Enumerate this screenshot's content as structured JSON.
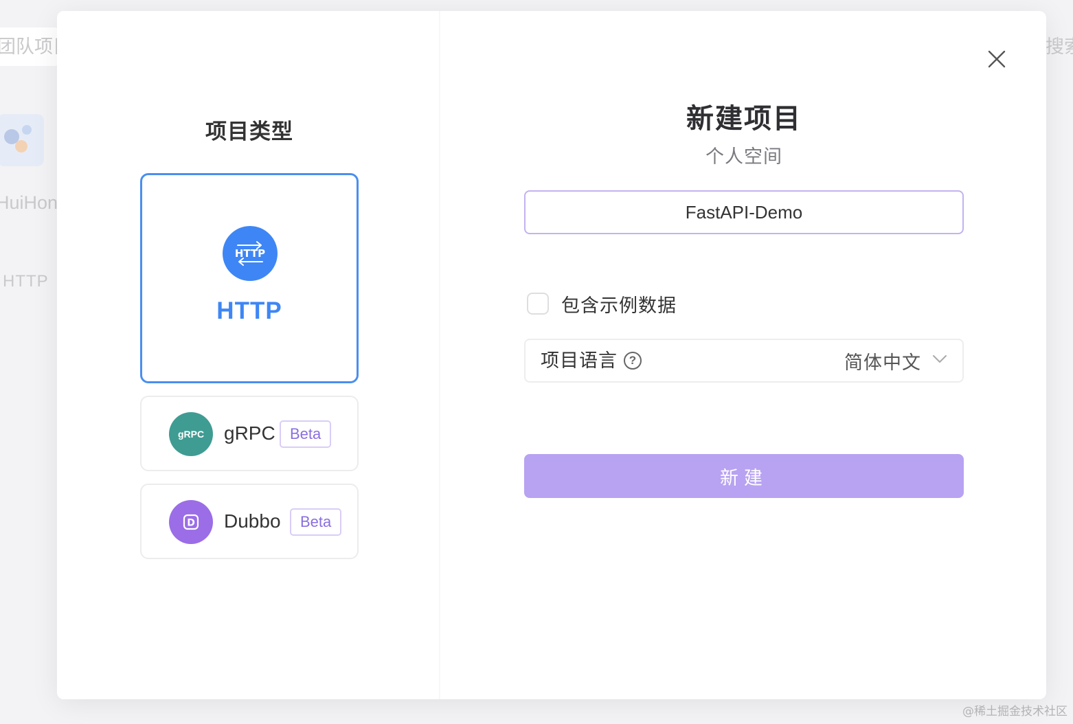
{
  "background": {
    "tab_label": "团队项目",
    "search_label": "搜索",
    "project_name": "HuiHong",
    "project_type": "HTTP"
  },
  "modal": {
    "left": {
      "title": "项目类型",
      "types": [
        {
          "name": "HTTP",
          "icon": "http-icon",
          "icon_text": "HTTP",
          "selected": true,
          "color": "#3e86f5"
        },
        {
          "name": "gRPC",
          "icon": "grpc-icon",
          "icon_text": "gRPC",
          "badge": "Beta",
          "color": "#3f9c93"
        },
        {
          "name": "Dubbo",
          "icon": "dubbo-icon",
          "icon_text": "D",
          "badge": "Beta",
          "color": "#9b6de7"
        }
      ]
    },
    "right": {
      "title": "新建项目",
      "subtitle": "个人空间",
      "name_input_value": "FastAPI-Demo",
      "include_sample_label": "包含示例数据",
      "include_sample_checked": false,
      "language_label": "项目语言",
      "language_value": "简体中文",
      "create_label": "新建"
    }
  },
  "watermark": "@稀土掘金技术社区",
  "colors": {
    "accent_blue": "#3e86f5",
    "accent_purple": "#b8a2f2",
    "badge_purple": "#8a6ee0"
  }
}
